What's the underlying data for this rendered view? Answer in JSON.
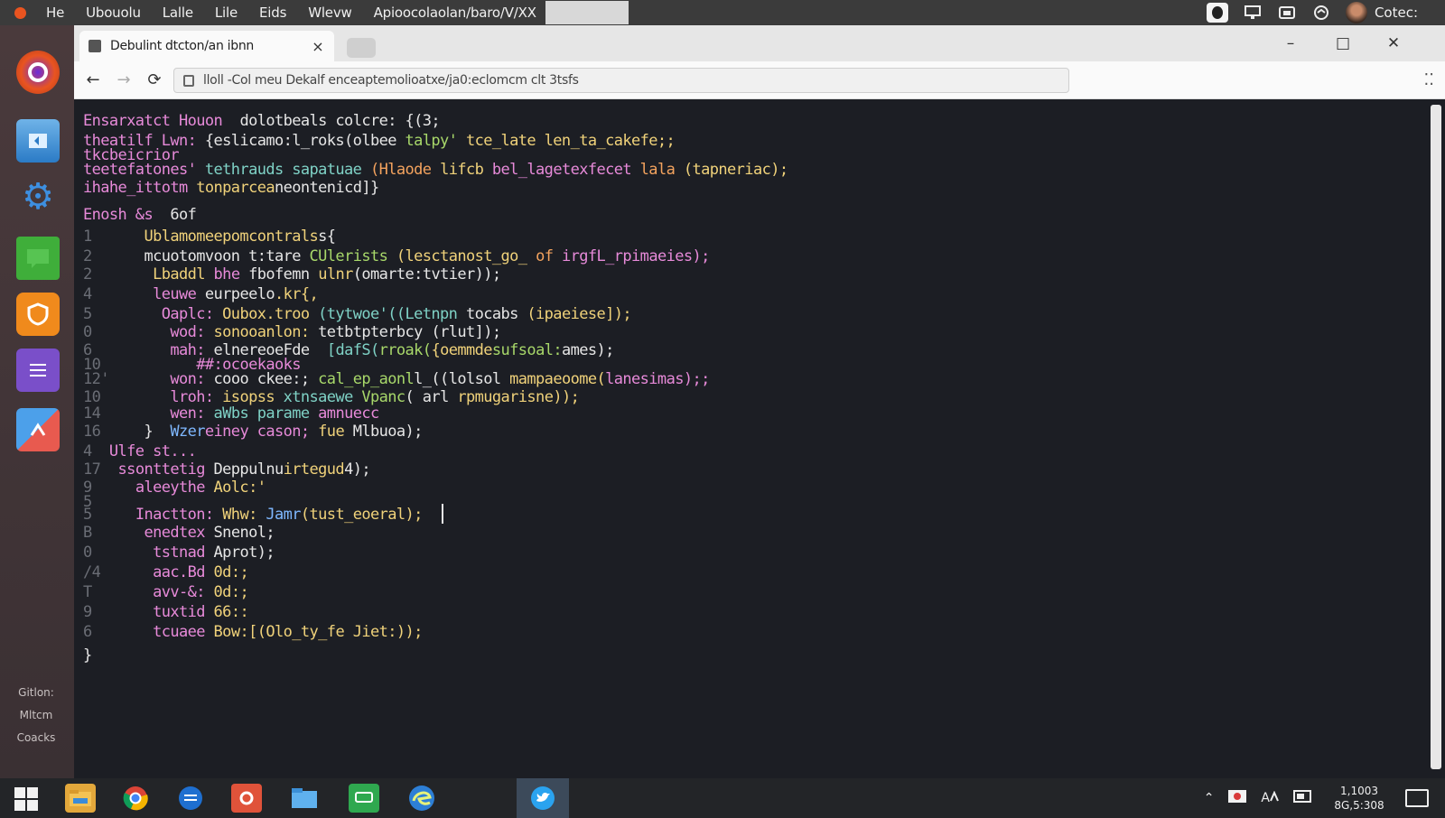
{
  "top_panel": {
    "menu": [
      "He",
      "Ubouolu",
      "Lalle",
      "Lile",
      "Eids",
      "Wlevw"
    ],
    "path": "Apioocolaolan/baro/V/XX",
    "user": "Cotec:"
  },
  "launcher": {
    "apps": [
      "ubuntu-icon",
      "files-icon",
      "settings-icon",
      "chat-icon",
      "shield-icon",
      "notes-icon",
      "tools-icon"
    ],
    "bottom_text": [
      "Gitlon:",
      "Mltcm",
      "Coacks"
    ]
  },
  "browser": {
    "tab_title": "Debulint dtcton/an ibnn",
    "tab_close": "×",
    "url": "lloll -Col meu Dekalf  enceaptemolioatxe/ja0:eclomcm clt 3tsfs",
    "window_controls": {
      "minimize": "–",
      "maximize": "□",
      "close": "✕"
    }
  },
  "code_lines": [
    [
      {
        "t": "Ensarxatct Houon  ",
        "c": "k"
      },
      {
        "t": "dolotbeals colcre: {(3;",
        "c": "w"
      }
    ],
    [
      {
        "t": "theatilf Lwn: ",
        "c": "k"
      },
      {
        "t": "{eslicamo:l_roks(olbee ",
        "c": "w"
      },
      {
        "t": "talpy' ",
        "c": "g"
      },
      {
        "t": "tce_late len_ta_cakefe;;",
        "c": "y"
      }
    ],
    [
      {
        "t": "tkcbeicrior",
        "c": "k"
      }
    ],
    [
      {
        "t": "teetefatones' ",
        "c": "k"
      },
      {
        "t": "tethrauds sapatuae ",
        "c": "c"
      },
      {
        "t": "(Hlaode ",
        "c": "o"
      },
      {
        "t": "lifcb ",
        "c": "y"
      },
      {
        "t": "bel_lagetexfecet ",
        "c": "k"
      },
      {
        "t": "lala ",
        "c": "o"
      },
      {
        "t": "(tapneriac);",
        "c": "y"
      }
    ],
    [
      {
        "t": "ihahe_ittotm ",
        "c": "k"
      },
      {
        "t": "tonparcea",
        "c": "y"
      },
      {
        "t": "neontenicd]}",
        "c": "w"
      }
    ],
    [
      {
        "t": "Enosh &s  ",
        "c": "k"
      },
      {
        "t": "6of",
        "c": "w"
      }
    ],
    [
      {
        "t": "1      ",
        "c": "ln"
      },
      {
        "t": "Ublamomeepomcontrals",
        "c": "y"
      },
      {
        "t": "s{",
        "c": "w"
      }
    ],
    [
      {
        "t": "2      ",
        "c": "ln"
      },
      {
        "t": "mcuotomvoon t:tare ",
        "c": "w"
      },
      {
        "t": "CUlerists ",
        "c": "g"
      },
      {
        "t": "(lesctanost_go_ ",
        "c": "y"
      },
      {
        "t": "of ",
        "c": "o"
      },
      {
        "t": "irgfL_rpimaeies);",
        "c": "k"
      }
    ],
    [
      {
        "t": "2       ",
        "c": "ln"
      },
      {
        "t": "Lbaddl ",
        "c": "y"
      },
      {
        "t": "bhe ",
        "c": "k"
      },
      {
        "t": "fbofemn ",
        "c": "w"
      },
      {
        "t": "ulnr",
        "c": "y"
      },
      {
        "t": "(omarte:tvtier));",
        "c": "w"
      }
    ],
    [
      {
        "t": "4       ",
        "c": "ln"
      },
      {
        "t": "leuwe ",
        "c": "k"
      },
      {
        "t": "eurpeelo",
        "c": "w"
      },
      {
        "t": ".kr{,",
        "c": "y"
      }
    ],
    [
      {
        "t": "5        ",
        "c": "ln"
      },
      {
        "t": "Oaplc: ",
        "c": "k"
      },
      {
        "t": "Oubox.troo ",
        "c": "y"
      },
      {
        "t": "(tytwoe'((Letnpn ",
        "c": "c"
      },
      {
        "t": "tocabs ",
        "c": "w"
      },
      {
        "t": "(ipaeiese]);",
        "c": "y"
      }
    ],
    [
      {
        "t": "0         ",
        "c": "ln"
      },
      {
        "t": "wod: ",
        "c": "k"
      },
      {
        "t": "sonooanlon: ",
        "c": "y"
      },
      {
        "t": "tetbtpterbcy ",
        "c": "w"
      },
      {
        "t": "(rlut]);",
        "c": "w"
      }
    ],
    [
      {
        "t": "6         ",
        "c": "ln"
      },
      {
        "t": "mah: ",
        "c": "k"
      },
      {
        "t": "elnereoeFde  ",
        "c": "w"
      },
      {
        "t": "[dafS(",
        "c": "c"
      },
      {
        "t": "rroak(",
        "c": "g"
      },
      {
        "t": "{oemmde",
        "c": "y"
      },
      {
        "t": "sufsoal:",
        "c": "g"
      },
      {
        "t": "ames);",
        "c": "w"
      }
    ],
    [
      {
        "t": "10           ",
        "c": "ln"
      },
      {
        "t": "##:ocoekaoks",
        "c": "k"
      }
    ],
    [
      {
        "t": "12'       ",
        "c": "ln"
      },
      {
        "t": "won: ",
        "c": "k"
      },
      {
        "t": "cooo ckee:; ",
        "c": "w"
      },
      {
        "t": "cal_ep_aonl",
        "c": "g"
      },
      {
        "t": "l_((lolsol ",
        "c": "w"
      },
      {
        "t": "mampaeoome(",
        "c": "y"
      },
      {
        "t": "lanesimas);;",
        "c": "k"
      }
    ],
    [
      {
        "t": "10        ",
        "c": "ln"
      },
      {
        "t": "lroh: ",
        "c": "k"
      },
      {
        "t": "isopss ",
        "c": "y"
      },
      {
        "t": "xtnsaewe ",
        "c": "c"
      },
      {
        "t": "Vpanc",
        "c": "g"
      },
      {
        "t": "( arl ",
        "c": "w"
      },
      {
        "t": "rpmugarisne));",
        "c": "y"
      }
    ],
    [
      {
        "t": "14        ",
        "c": "ln"
      },
      {
        "t": "wen: ",
        "c": "k"
      },
      {
        "t": "aWbs parame ",
        "c": "c"
      },
      {
        "t": "amnuecc",
        "c": "k"
      }
    ],
    [
      {
        "t": "16     ",
        "c": "ln"
      },
      {
        "t": "}  ",
        "c": "w"
      },
      {
        "t": "Wzer",
        "c": "b"
      },
      {
        "t": "einey cason; ",
        "c": "k"
      },
      {
        "t": "fue ",
        "c": "y"
      },
      {
        "t": "Mlbuoa);",
        "c": "w"
      }
    ],
    [
      {
        "t": "4  ",
        "c": "ln"
      },
      {
        "t": "Ulfe st...",
        "c": "k"
      }
    ],
    [
      {
        "t": "17  ",
        "c": "ln"
      },
      {
        "t": "ssonttetig ",
        "c": "k"
      },
      {
        "t": "Deppulnu",
        "c": "w"
      },
      {
        "t": "irtegud",
        "c": "y"
      },
      {
        "t": "4);",
        "c": "w"
      }
    ],
    [
      {
        "t": "9     ",
        "c": "ln"
      },
      {
        "t": "aleeythe ",
        "c": "k"
      },
      {
        "t": "Aolc:'",
        "c": "y"
      }
    ],
    [
      {
        "t": "5",
        "c": "ln"
      }
    ],
    [
      {
        "t": "5     ",
        "c": "ln"
      },
      {
        "t": "Inactton: ",
        "c": "k"
      },
      {
        "t": "Whw: ",
        "c": "y"
      },
      {
        "t": "Jamr",
        "c": "b"
      },
      {
        "t": "(tust_eoeral); ",
        "c": "y"
      }
    ],
    [
      {
        "t": "B      ",
        "c": "ln"
      },
      {
        "t": "enedtex ",
        "c": "k"
      },
      {
        "t": "Snenol;",
        "c": "w"
      }
    ],
    [
      {
        "t": "0       ",
        "c": "ln"
      },
      {
        "t": "tstnad ",
        "c": "k"
      },
      {
        "t": "Aprot);",
        "c": "w"
      }
    ],
    [
      {
        "t": "/4      ",
        "c": "ln"
      },
      {
        "t": "aac.Bd ",
        "c": "k"
      },
      {
        "t": "0d:;",
        "c": "y"
      }
    ],
    [
      {
        "t": "T       ",
        "c": "ln"
      },
      {
        "t": "avv-&: ",
        "c": "k"
      },
      {
        "t": "0d:;",
        "c": "y"
      }
    ],
    [
      {
        "t": "9       ",
        "c": "ln"
      },
      {
        "t": "tuxtid ",
        "c": "k"
      },
      {
        "t": "66::",
        "c": "y"
      }
    ],
    [
      {
        "t": "6       ",
        "c": "ln"
      },
      {
        "t": "tcuaee ",
        "c": "k"
      },
      {
        "t": "Bow:",
        "c": "y"
      },
      {
        "t": "[(Olo_ty_fe ",
        "c": "y"
      },
      {
        "t": "Jiet:));",
        "c": "y"
      }
    ],
    [
      {
        "t": "}",
        "c": "w"
      }
    ]
  ],
  "taskbar": {
    "apps": [
      "file-explorer-icon",
      "chrome-icon",
      "mail-icon",
      "media-icon",
      "folder-icon",
      "messages-icon",
      "edge-icon",
      "twitter-icon"
    ],
    "clock_time": "1,1003",
    "clock_date": "8G,5:308",
    "tray_label": "A"
  }
}
